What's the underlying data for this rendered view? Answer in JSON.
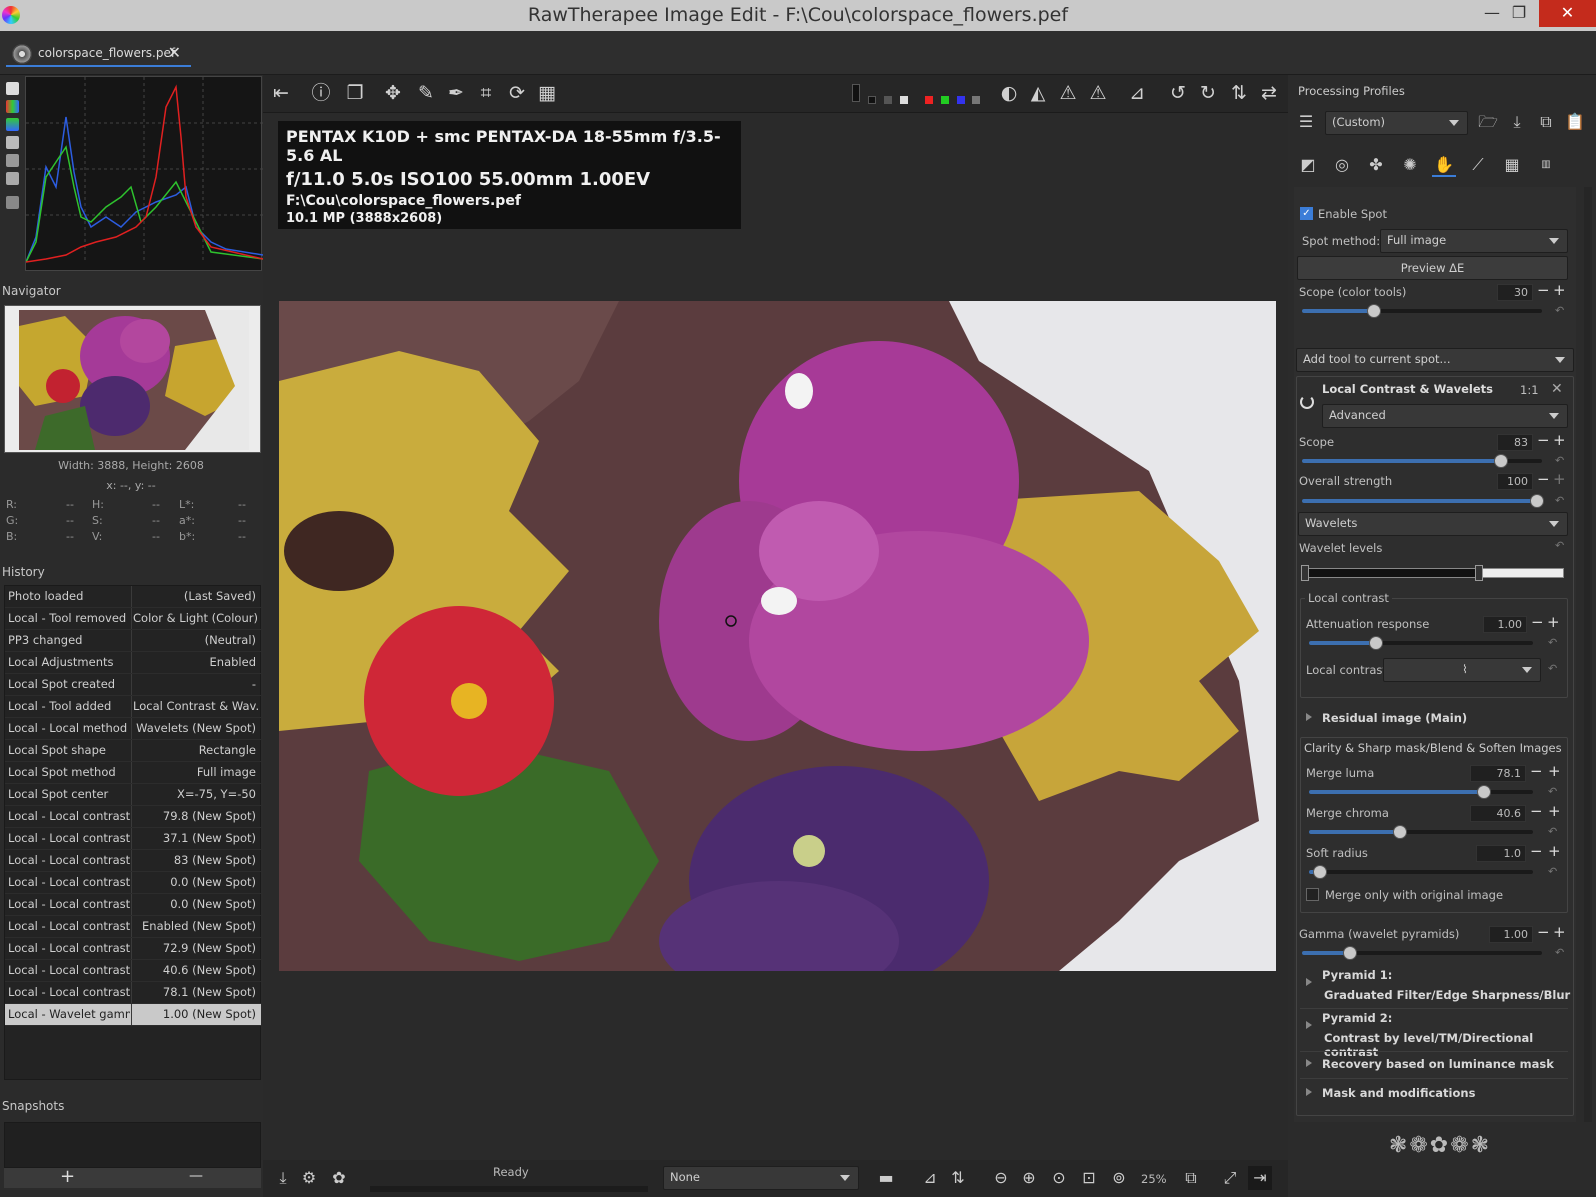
{
  "window": {
    "title": "RawTherapee Image Edit - F:\\Cou\\colorspace_flowers.pef",
    "minimize": "—",
    "maximize": "❐",
    "close": "✕"
  },
  "tab": {
    "label": "colorspace_flowers.pef",
    "close": "✕"
  },
  "navigator": {
    "title": "Navigator",
    "size": "Width: 3888, Height: 2608",
    "coords": "x: --, y: --",
    "readouts": [
      {
        "l1": "R:",
        "v1": "--",
        "l2": "H:",
        "v2": "--",
        "l3": "L*:",
        "v3": "--"
      },
      {
        "l1": "G:",
        "v1": "--",
        "l2": "S:",
        "v2": "--",
        "l3": "a*:",
        "v3": "--"
      },
      {
        "l1": "B:",
        "v1": "--",
        "l2": "V:",
        "v2": "--",
        "l3": "b*:",
        "v3": "--"
      }
    ]
  },
  "history": {
    "title": "History",
    "rows": [
      {
        "action": "Photo loaded",
        "value": "(Last Saved)"
      },
      {
        "action": "Local - Tool removed",
        "value": "Color & Light (Colour)"
      },
      {
        "action": "PP3 changed",
        "value": "(Neutral)"
      },
      {
        "action": "Local Adjustments",
        "value": "Enabled"
      },
      {
        "action": "Local Spot created",
        "value": "-"
      },
      {
        "action": "Local - Tool added",
        "value": "Local Contrast & Wav..."
      },
      {
        "action": "Local - Local method",
        "value": "Wavelets (New Spot)"
      },
      {
        "action": "Local Spot shape",
        "value": "Rectangle"
      },
      {
        "action": "Local Spot method",
        "value": "Full image"
      },
      {
        "action": "Local Spot center",
        "value": "X=-75, Y=-50"
      },
      {
        "action": "Local - Local contrast ...",
        "value": "79.8 (New Spot)"
      },
      {
        "action": "Local - Local contrast ...",
        "value": "37.1 (New Spot)"
      },
      {
        "action": "Local - Local contrast ...",
        "value": "83 (New Spot)"
      },
      {
        "action": "Local - Local contrast ...",
        "value": "0.0 (New Spot)"
      },
      {
        "action": "Local - Local contrast ...",
        "value": "0.0 (New Spot)"
      },
      {
        "action": "Local - Local contrast",
        "value": "Enabled (New Spot)"
      },
      {
        "action": "Local - Local contrast ...",
        "value": "72.9 (New Spot)"
      },
      {
        "action": "Local - Local contrast ...",
        "value": "40.6 (New Spot)"
      },
      {
        "action": "Local - Local contrast ...",
        "value": "78.1 (New Spot)"
      },
      {
        "action": "Local - Wavelet gamma",
        "value": "1.00 (New Spot)"
      }
    ]
  },
  "snapshots": {
    "title": "Snapshots",
    "add": "+",
    "remove": "—"
  },
  "exif": {
    "line1": "PENTAX K10D + smc PENTAX-DA 18-55mm f/3.5-5.6 AL",
    "line2": "f/11.0  5.0s  ISO100  55.00mm  1.00EV",
    "line3": "F:\\Cou\\colorspace_flowers.pef",
    "line4": "10.1 MP (3888x2608)"
  },
  "statusbar": {
    "status": "Ready",
    "profile": "None",
    "zoom": "25%"
  },
  "processing": {
    "title": "Processing Profiles",
    "profile": "(Custom)"
  },
  "spot": {
    "enable_label": "Enable Spot",
    "method_label": "Spot method:",
    "method_value": "Full image",
    "preview_button": "Preview ΔE",
    "scope_label": "Scope (color tools)",
    "scope_value": "30",
    "add_tool": "Add tool to current spot..."
  },
  "lcw": {
    "title": "Local Contrast & Wavelets",
    "ratio": "1:1",
    "mode": "Advanced",
    "scope_label": "Scope",
    "scope_value": "83",
    "strength_label": "Overall strength",
    "strength_value": "100",
    "wavelets": "Wavelets",
    "wavelet_levels": "Wavelet levels",
    "local_contrast_title": "Local contrast",
    "attenuation_label": "Attenuation response",
    "attenuation_value": "1.00",
    "local_contrast_label": "Local contrast:",
    "residual": "Residual image (Main)",
    "clarity_title": "Clarity & Sharp mask/Blend & Soften Images",
    "merge_luma_label": "Merge luma",
    "merge_luma_value": "78.1",
    "merge_chroma_label": "Merge chroma",
    "merge_chroma_value": "40.6",
    "soft_radius_label": "Soft radius",
    "soft_radius_value": "1.0",
    "merge_only": "Merge only with original image",
    "gamma_label": "Gamma (wavelet pyramids)",
    "gamma_value": "1.00",
    "pyramid1_title": "Pyramid 1:",
    "pyramid1_sub": "Graduated Filter/Edge Sharpness/Blur",
    "pyramid2_title": "Pyramid 2:",
    "pyramid2_sub": "Contrast by level/TM/Directional contrast",
    "recovery": "Recovery based on luminance mask",
    "mask": "Mask and modifications"
  },
  "levels": {
    "scope": 0.83,
    "strength": 1.0,
    "color_scope": 0.3,
    "attenuation": 0.3,
    "merge_luma": 0.781,
    "merge_chroma": 0.406,
    "soft_radius": 0.05,
    "gamma": 0.2
  },
  "colors": {
    "accent": "#3b7dd8",
    "selected_row": "#c9c9c9"
  }
}
